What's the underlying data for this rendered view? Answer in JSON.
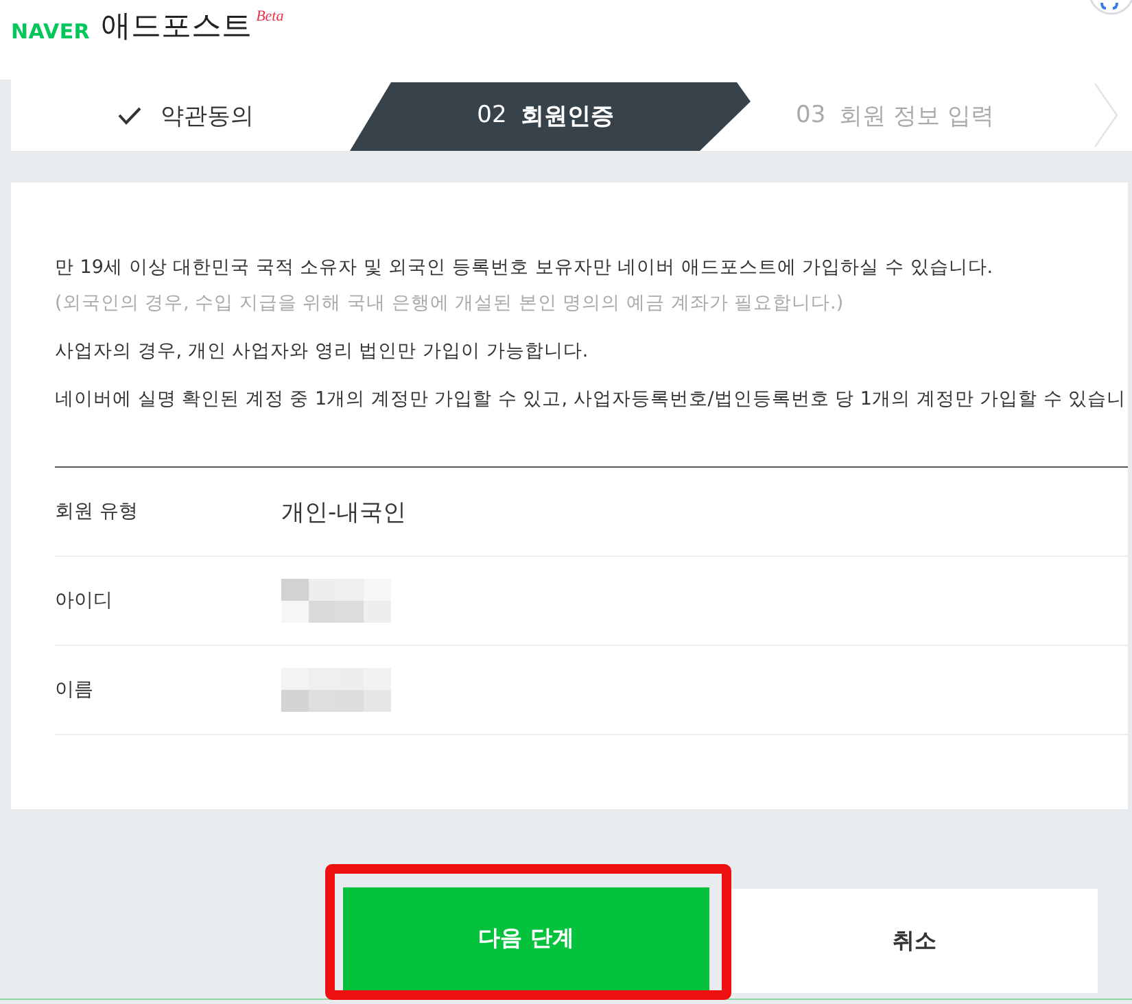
{
  "header": {
    "brand": "NAVER",
    "product": "애드포스트",
    "badge": "Beta"
  },
  "steps": [
    {
      "label": "약관동의",
      "completed": true,
      "selected": false
    },
    {
      "number": "02",
      "label": "회원인증",
      "completed": false,
      "selected": true
    },
    {
      "number": "03",
      "label": "회원 정보 입력",
      "completed": false,
      "selected": false
    }
  ],
  "notices": [
    {
      "kind": "body",
      "text": "만 19세 이상 대한민국 국적 소유자 및 외국인 등록번호 보유자만 네이버 애드포스트에 가입하실 수 있습니다."
    },
    {
      "kind": "note",
      "text": "(외국인의 경우, 수입 지급을 위해 국내 은행에 개설된 본인 명의의 예금 계좌가 필요합니다.)"
    },
    {
      "kind": "body",
      "text": "사업자의 경우, 개인 사업자와 영리 법인만 가입이 가능합니다."
    },
    {
      "kind": "body",
      "text": "네이버에 실명 확인된 계정 중 1개의 계정만 가입할 수 있고, 사업자등록번호/법인등록번호 당 1개의 계정만 가입할 수 있습니"
    }
  ],
  "member_info": [
    {
      "label": "회원 유형",
      "kind": "text",
      "value": "개인-내국인"
    },
    {
      "label": "아이디",
      "kind": "masked"
    },
    {
      "label": "이름",
      "kind": "masked"
    }
  ],
  "buttons": [
    {
      "label": "다음 단계",
      "kind": "primary",
      "highlighted": true
    },
    {
      "label": "취소",
      "kind": "secondary",
      "highlighted": false
    }
  ]
}
